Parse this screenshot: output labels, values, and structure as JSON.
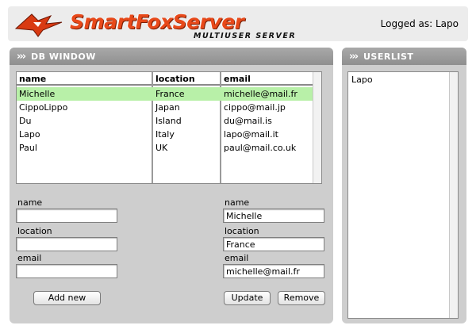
{
  "header": {
    "logo_text": "SmartFoxServer",
    "logo_subtitle": "MULTIUSER SERVER",
    "logged_as": "Logged as: Lapo"
  },
  "db_window": {
    "title": "DB WINDOW",
    "columns": [
      "name",
      "location",
      "email"
    ],
    "rows": [
      {
        "name": "Michelle",
        "location": "France",
        "email": "michelle@mail.fr",
        "selected": true
      },
      {
        "name": "CippoLippo",
        "location": "Japan",
        "email": "cippo@mail.jp",
        "selected": false
      },
      {
        "name": "Du",
        "location": "Island",
        "email": "du@mail.is",
        "selected": false
      },
      {
        "name": "Lapo",
        "location": "Italy",
        "email": "lapo@mail.it",
        "selected": false
      },
      {
        "name": "Paul",
        "location": "UK",
        "email": "paul@mail.co.uk",
        "selected": false
      }
    ],
    "add_form": {
      "name_label": "name",
      "name_value": "",
      "location_label": "location",
      "location_value": "",
      "email_label": "email",
      "email_value": "",
      "add_button": "Add new"
    },
    "edit_form": {
      "name_label": "name",
      "name_value": "Michelle",
      "location_label": "location",
      "location_value": "France",
      "email_label": "email",
      "email_value": "michelle@mail.fr",
      "update_button": "Update",
      "remove_button": "Remove"
    }
  },
  "userlist": {
    "title": "USERLIST",
    "users": [
      "Lapo"
    ]
  },
  "colors": {
    "selected_row": "#b8f0a8",
    "panel_bg": "#cecece",
    "panel_header": "#9a9a9a",
    "logo_orange": "#e8491a"
  }
}
